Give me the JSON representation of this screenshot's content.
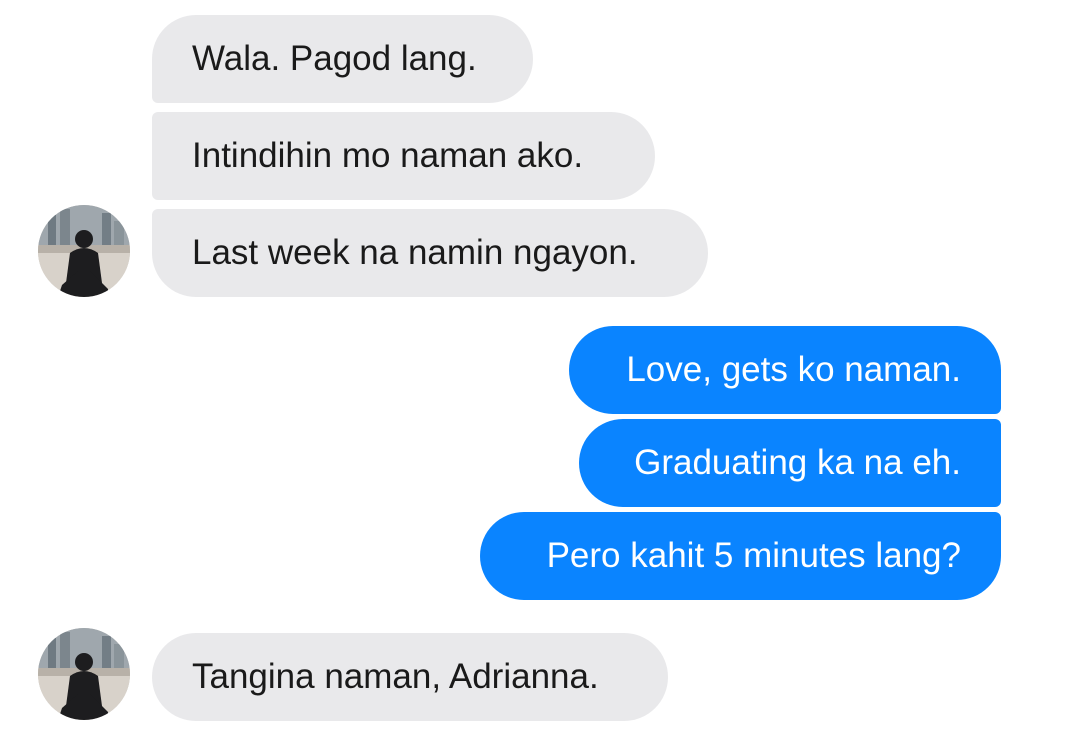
{
  "conversation": {
    "incoming_1": "Wala. Pagod lang.",
    "incoming_2": "Intindihin mo naman ako.",
    "incoming_3": "Last week na namin ngayon.",
    "outgoing_1": "Love, gets ko naman.",
    "outgoing_2": "Graduating ka na eh.",
    "outgoing_3": "Pero kahit 5 minutes lang?",
    "incoming_4": "Tangina naman, Adrianna."
  },
  "colors": {
    "incoming_bubble": "#e9e9eb",
    "outgoing_bubble": "#0a84ff",
    "incoming_text": "#1a1a1a",
    "outgoing_text": "#ffffff"
  },
  "icons": {
    "contact_avatar": "avatar-photo"
  }
}
